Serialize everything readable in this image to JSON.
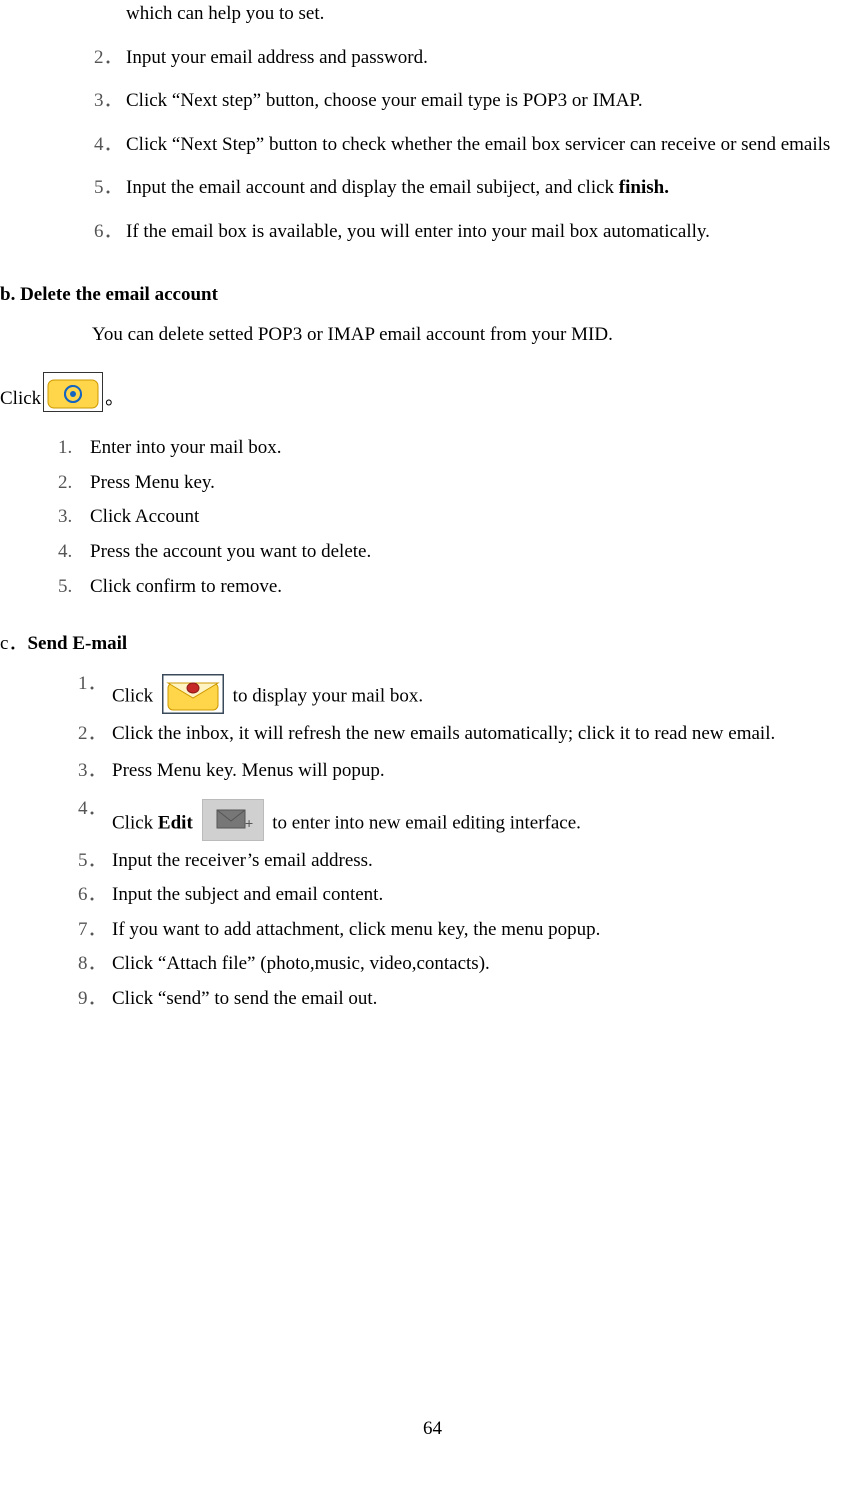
{
  "section_a": {
    "item1_cont": "which can help you to set.",
    "items": [
      "Input your email address and password.",
      "Click “Next step” button, choose your email type is POP3 or IMAP.",
      "Click “Next Step” button to check whether the email box servicer can receive or send emails",
      {
        "pre": "Input the email account and display the email subiject, and click ",
        "bold": "finish."
      },
      "If the email box is available, you will enter into your mail box automatically."
    ]
  },
  "section_b": {
    "heading": "b. Delete the email account",
    "intro": "You can delete setted POP3 or IMAP email account from your MID.",
    "click_label": "Click",
    "click_suffix": "。",
    "items": [
      "Enter into your mail box.",
      "Press Menu key.",
      "Click Account",
      "Press the account you want to delete.",
      "Click confirm to remove."
    ]
  },
  "section_c": {
    "heading_pre": "c．",
    "heading": "Send E-mail",
    "items": {
      "i1_pre": "Click ",
      "i1_post": " to display your mail box.",
      "i2": "Click the inbox, it will refresh the new emails automatically; click it to read new email.",
      "i3": "Press Menu key. Menus will popup.",
      "i4_pre": "Click ",
      "i4_bold": "Edit",
      "i4_post": "  to enter into new email editing interface.",
      "i5": "Input the receiver’s email address.",
      "i6": "Input the subject and email content.",
      "i7": "If you want to add attachment, click menu key, the menu popup.",
      "i8": "Click “Attach file” (photo,music, video,contacts).",
      "i9": "Click “send” to send the email out."
    }
  },
  "page_number": "64"
}
